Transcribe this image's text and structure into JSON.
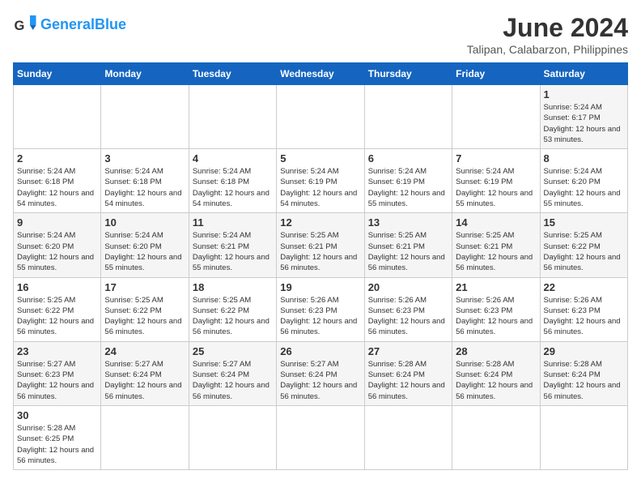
{
  "header": {
    "logo_general": "General",
    "logo_blue": "Blue",
    "month_title": "June 2024",
    "location": "Talipan, Calabarzon, Philippines"
  },
  "weekdays": [
    "Sunday",
    "Monday",
    "Tuesday",
    "Wednesday",
    "Thursday",
    "Friday",
    "Saturday"
  ],
  "weeks": [
    [
      {
        "day": "",
        "info": ""
      },
      {
        "day": "",
        "info": ""
      },
      {
        "day": "",
        "info": ""
      },
      {
        "day": "",
        "info": ""
      },
      {
        "day": "",
        "info": ""
      },
      {
        "day": "",
        "info": ""
      },
      {
        "day": "1",
        "info": "Sunrise: 5:24 AM\nSunset: 6:17 PM\nDaylight: 12 hours and 53 minutes."
      }
    ],
    [
      {
        "day": "2",
        "info": "Sunrise: 5:24 AM\nSunset: 6:18 PM\nDaylight: 12 hours and 54 minutes."
      },
      {
        "day": "3",
        "info": "Sunrise: 5:24 AM\nSunset: 6:18 PM\nDaylight: 12 hours and 54 minutes."
      },
      {
        "day": "4",
        "info": "Sunrise: 5:24 AM\nSunset: 6:18 PM\nDaylight: 12 hours and 54 minutes."
      },
      {
        "day": "5",
        "info": "Sunrise: 5:24 AM\nSunset: 6:19 PM\nDaylight: 12 hours and 54 minutes."
      },
      {
        "day": "6",
        "info": "Sunrise: 5:24 AM\nSunset: 6:19 PM\nDaylight: 12 hours and 55 minutes."
      },
      {
        "day": "7",
        "info": "Sunrise: 5:24 AM\nSunset: 6:19 PM\nDaylight: 12 hours and 55 minutes."
      },
      {
        "day": "8",
        "info": "Sunrise: 5:24 AM\nSunset: 6:20 PM\nDaylight: 12 hours and 55 minutes."
      }
    ],
    [
      {
        "day": "9",
        "info": "Sunrise: 5:24 AM\nSunset: 6:20 PM\nDaylight: 12 hours and 55 minutes."
      },
      {
        "day": "10",
        "info": "Sunrise: 5:24 AM\nSunset: 6:20 PM\nDaylight: 12 hours and 55 minutes."
      },
      {
        "day": "11",
        "info": "Sunrise: 5:24 AM\nSunset: 6:21 PM\nDaylight: 12 hours and 55 minutes."
      },
      {
        "day": "12",
        "info": "Sunrise: 5:25 AM\nSunset: 6:21 PM\nDaylight: 12 hours and 56 minutes."
      },
      {
        "day": "13",
        "info": "Sunrise: 5:25 AM\nSunset: 6:21 PM\nDaylight: 12 hours and 56 minutes."
      },
      {
        "day": "14",
        "info": "Sunrise: 5:25 AM\nSunset: 6:21 PM\nDaylight: 12 hours and 56 minutes."
      },
      {
        "day": "15",
        "info": "Sunrise: 5:25 AM\nSunset: 6:22 PM\nDaylight: 12 hours and 56 minutes."
      }
    ],
    [
      {
        "day": "16",
        "info": "Sunrise: 5:25 AM\nSunset: 6:22 PM\nDaylight: 12 hours and 56 minutes."
      },
      {
        "day": "17",
        "info": "Sunrise: 5:25 AM\nSunset: 6:22 PM\nDaylight: 12 hours and 56 minutes."
      },
      {
        "day": "18",
        "info": "Sunrise: 5:25 AM\nSunset: 6:22 PM\nDaylight: 12 hours and 56 minutes."
      },
      {
        "day": "19",
        "info": "Sunrise: 5:26 AM\nSunset: 6:23 PM\nDaylight: 12 hours and 56 minutes."
      },
      {
        "day": "20",
        "info": "Sunrise: 5:26 AM\nSunset: 6:23 PM\nDaylight: 12 hours and 56 minutes."
      },
      {
        "day": "21",
        "info": "Sunrise: 5:26 AM\nSunset: 6:23 PM\nDaylight: 12 hours and 56 minutes."
      },
      {
        "day": "22",
        "info": "Sunrise: 5:26 AM\nSunset: 6:23 PM\nDaylight: 12 hours and 56 minutes."
      }
    ],
    [
      {
        "day": "23",
        "info": "Sunrise: 5:27 AM\nSunset: 6:23 PM\nDaylight: 12 hours and 56 minutes."
      },
      {
        "day": "24",
        "info": "Sunrise: 5:27 AM\nSunset: 6:24 PM\nDaylight: 12 hours and 56 minutes."
      },
      {
        "day": "25",
        "info": "Sunrise: 5:27 AM\nSunset: 6:24 PM\nDaylight: 12 hours and 56 minutes."
      },
      {
        "day": "26",
        "info": "Sunrise: 5:27 AM\nSunset: 6:24 PM\nDaylight: 12 hours and 56 minutes."
      },
      {
        "day": "27",
        "info": "Sunrise: 5:28 AM\nSunset: 6:24 PM\nDaylight: 12 hours and 56 minutes."
      },
      {
        "day": "28",
        "info": "Sunrise: 5:28 AM\nSunset: 6:24 PM\nDaylight: 12 hours and 56 minutes."
      },
      {
        "day": "29",
        "info": "Sunrise: 5:28 AM\nSunset: 6:24 PM\nDaylight: 12 hours and 56 minutes."
      }
    ],
    [
      {
        "day": "30",
        "info": "Sunrise: 5:28 AM\nSunset: 6:25 PM\nDaylight: 12 hours and 56 minutes."
      },
      {
        "day": "",
        "info": ""
      },
      {
        "day": "",
        "info": ""
      },
      {
        "day": "",
        "info": ""
      },
      {
        "day": "",
        "info": ""
      },
      {
        "day": "",
        "info": ""
      },
      {
        "day": "",
        "info": ""
      }
    ]
  ]
}
